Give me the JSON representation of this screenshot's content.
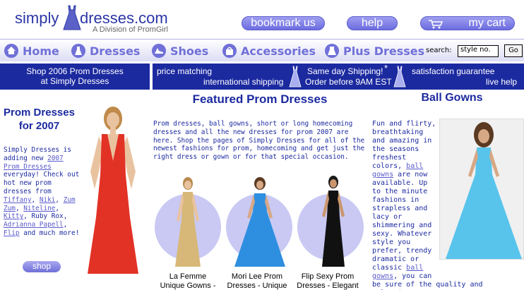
{
  "header": {
    "logo_left": "simply",
    "logo_right": "dresses.com",
    "logo_sub": "A Division of PromGirl",
    "buttons": {
      "bookmark": "bookmark us",
      "help": "help",
      "cart": "my cart"
    }
  },
  "nav": {
    "items": [
      "Home",
      "Dresses",
      "Shoes",
      "Accessories",
      "Plus Dresses"
    ],
    "search_label": "search:",
    "search_value": "style no.",
    "go_label": "Go"
  },
  "bars": {
    "left": [
      "Shop 2006 Prom Dresses",
      "at Simply Dresses"
    ],
    "price_matching": "price matching",
    "intl_shipping": "international shipping",
    "same_day": "Same day Shipping!",
    "asterisk": "*",
    "order_before": "Order before 9AM EST",
    "satisfaction": "satisfaction guarantee",
    "live_help": "live help"
  },
  "left_column": {
    "title": "Prom Dresses for 2007",
    "intro": "Simply Dresses is adding new ",
    "link_prom": "2007 Prom Dresses",
    "mid": " everyday! Check out hot new prom dresses from ",
    "brands": [
      "Tiffany",
      "Niki",
      "Zum Zum",
      "Niteline",
      "Kitty"
    ],
    "ruby": "Ruby Rox",
    "brand_adrianna": "Adrianna Papell",
    "brand_flip": "Flip",
    "outro": " and much more!",
    "shop_label": "shop"
  },
  "middle_column": {
    "title": "Featured Prom Dresses",
    "body": "Prom dresses, ball gowns, short or long homecoming dresses and all the new dresses for prom 2007 are here. Shop the pages of Simply Dresses for all of the newest fashions for prom, homecoming and get just the right dress or gown or for that special occasion.",
    "captions": [
      [
        "La Femme",
        "Unique Gowns -"
      ],
      [
        "Mori Lee Prom",
        "Dresses - Unique"
      ],
      [
        "Flip Sexy Prom",
        "Dresses - Elegant"
      ]
    ]
  },
  "right_column": {
    "title": "Ball Gowns",
    "p1": "Fun and flirty, breathtaking and amazing in the seasons freshest colors, ",
    "link1": "ball gowns",
    "p2": " are now available. Up to the minute fashions in strapless and lacy or shimmering and sexy. Whatever style you prefer, trendy dramatic or classic ",
    "link2": "ball gowns",
    "p3": ", you can",
    "p4": "be sure of the quality and selection."
  },
  "colors": {
    "brand_blue": "#1c2aa0",
    "nav_purple": "#7070d8",
    "circle": "#c9c9f4"
  }
}
